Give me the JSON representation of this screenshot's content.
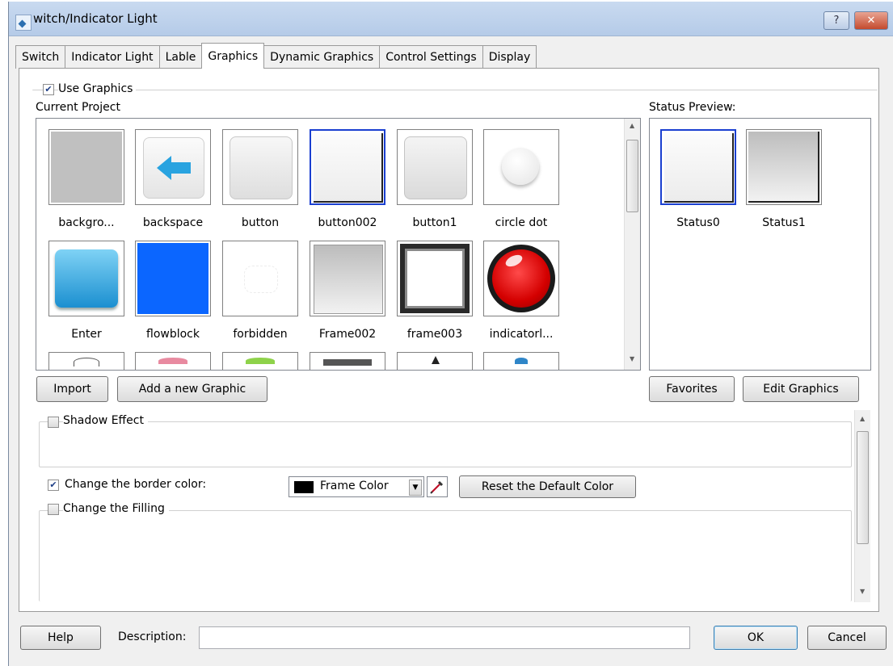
{
  "window": {
    "title": "witch/Indicator Light",
    "help_glyph": "?",
    "close_glyph": "✕"
  },
  "tabs": [
    "Switch",
    "Indicator Light",
    "Lable",
    "Graphics",
    "Dynamic Graphics",
    "Control Settings",
    "Display"
  ],
  "active_tab": "Graphics",
  "use_graphics": {
    "label": "Use Graphics",
    "checked": true
  },
  "current_project": {
    "label": "Current Project",
    "graphics": [
      {
        "name": "backgro...",
        "icon": "gray-square-icon"
      },
      {
        "name": "backspace",
        "icon": "backspace-arrow-icon"
      },
      {
        "name": "button",
        "icon": "button-graphic-icon"
      },
      {
        "name": "button002",
        "icon": "button002-graphic-icon",
        "selected": true
      },
      {
        "name": "button1",
        "icon": "button1-graphic-icon"
      },
      {
        "name": "circle dot",
        "icon": "circle-dot-icon"
      },
      {
        "name": "Enter",
        "icon": "enter-graphic-icon"
      },
      {
        "name": "flowblock",
        "icon": "flowblock-graphic-icon"
      },
      {
        "name": "forbidden",
        "icon": "forbidden-graphic-icon"
      },
      {
        "name": "Frame002",
        "icon": "frame002-graphic-icon"
      },
      {
        "name": "frame003",
        "icon": "frame003-graphic-icon"
      },
      {
        "name": "indicatorl...",
        "icon": "red-indicator-light-icon"
      }
    ]
  },
  "status_preview": {
    "label": "Status Preview:",
    "items": [
      {
        "name": "Status0",
        "icon": "status0-graphic-icon"
      },
      {
        "name": "Status1",
        "icon": "status1-graphic-icon"
      }
    ]
  },
  "buttons": {
    "import": "Import",
    "add_graphic": "Add a new Graphic",
    "favorites": "Favorites",
    "edit_graphics": "Edit Graphics",
    "reset_color": "Reset the Default Color",
    "help": "Help",
    "ok": "OK",
    "cancel": "Cancel"
  },
  "shadow_effect": {
    "label": "Shadow Effect",
    "checked": false
  },
  "border_color": {
    "label": "Change the border color:",
    "checked": true,
    "selected": "Frame Color",
    "swatch_color": "#000000"
  },
  "filling": {
    "label": "Change the Filling",
    "checked": false
  },
  "description": {
    "label": "Description:",
    "value": ""
  },
  "colors": {
    "selection_border": "#1a3fd0",
    "indicator_red": "#e00000",
    "flowblock_blue": "#0b66ff"
  }
}
